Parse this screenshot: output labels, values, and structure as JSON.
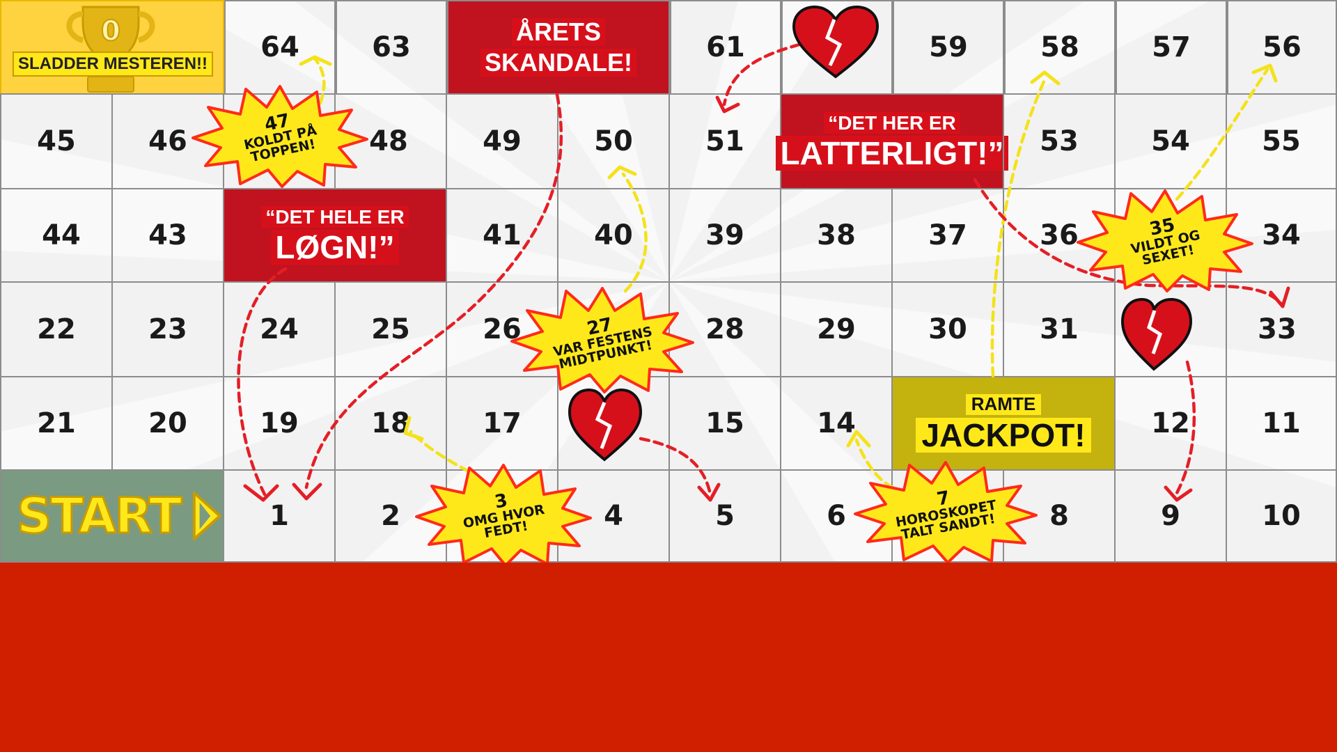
{
  "board": {
    "rows": [
      [
        "",
        "64",
        "63",
        "",
        "61",
        "",
        "59",
        "58",
        "57",
        "56"
      ],
      [
        "45",
        "46",
        "",
        "48",
        "49",
        "50",
        "51",
        "",
        "53",
        "54",
        "55"
      ],
      [
        "44",
        "43",
        "",
        "",
        "41",
        "40",
        "39",
        "38",
        "37",
        "36",
        "34"
      ],
      [
        "22",
        "23",
        "24",
        "25",
        "26",
        "",
        "28",
        "29",
        "30",
        "31",
        "",
        "33"
      ],
      [
        "21",
        "20",
        "19",
        "18",
        "17",
        "",
        "15",
        "14",
        "",
        "",
        "12",
        "11"
      ],
      [
        "",
        "",
        "1",
        "2",
        "",
        "4",
        "5",
        "6",
        "",
        "8",
        "9",
        "10"
      ]
    ],
    "cells": {
      "r0": [
        "64",
        "63",
        "61",
        "59",
        "58",
        "57",
        "56"
      ],
      "r1": [
        "45",
        "46",
        "48",
        "49",
        "50",
        "51",
        "53",
        "54",
        "55"
      ],
      "r2": [
        "44",
        "43",
        "41",
        "40",
        "39",
        "38",
        "37",
        "36",
        "34"
      ],
      "r3": [
        "22",
        "23",
        "24",
        "25",
        "26",
        "28",
        "29",
        "30",
        "31",
        "33"
      ],
      "r4": [
        "21",
        "20",
        "19",
        "18",
        "17",
        "15",
        "14",
        "12",
        "11"
      ],
      "r5": [
        "1",
        "2",
        "4",
        "5",
        "6",
        "8",
        "9",
        "10"
      ]
    }
  },
  "special": {
    "finish": {
      "number": "0",
      "label": "SLADDER MESTEREN!!"
    },
    "start": {
      "label": "START"
    },
    "arets": {
      "line1": "ÅRETS",
      "line2": "SKANDALE!"
    },
    "latterligt": {
      "line1": "“DET HER ER",
      "line2": "LATTERLIGT!”"
    },
    "logn": {
      "line1": "“DET HELE ER",
      "line2": "LØGN!”"
    },
    "jackpot": {
      "line1": "RAMTE",
      "line2": "JACKPOT!"
    }
  },
  "bursts": [
    {
      "number": "47",
      "lines": [
        "KOLDT PÅ",
        "TOPPEN!"
      ]
    },
    {
      "number": "35",
      "lines": [
        "VILDT OG",
        "SEXET!"
      ]
    },
    {
      "number": "27",
      "lines": [
        "VAR FESTENS",
        "MIDTPUNKT!"
      ]
    },
    {
      "number": "3",
      "lines": [
        "OMG HVOR",
        "FEDT!"
      ]
    },
    {
      "number": "7",
      "lines": [
        "HOROSKOPET",
        "TALT SANDT!"
      ]
    }
  ],
  "colors": {
    "background": "#d01f00",
    "board": "#f2f2f2",
    "grid": "#8c8c8c",
    "scandal_red": "#c1121f",
    "tag_red": "#d6101b",
    "ladder_yellow": "#ffe81a",
    "burst_outline": "#ff2a1a",
    "finish_gold": "#ffd23f",
    "jackpot_olive": "#c4b20f",
    "start_green": "#7a9a82",
    "snake_red": "#e41e26"
  },
  "icons": [
    "trophy-icon",
    "broken-heart-icon",
    "play-arrow-icon",
    "starburst-icon",
    "dashed-arrow-icon"
  ]
}
